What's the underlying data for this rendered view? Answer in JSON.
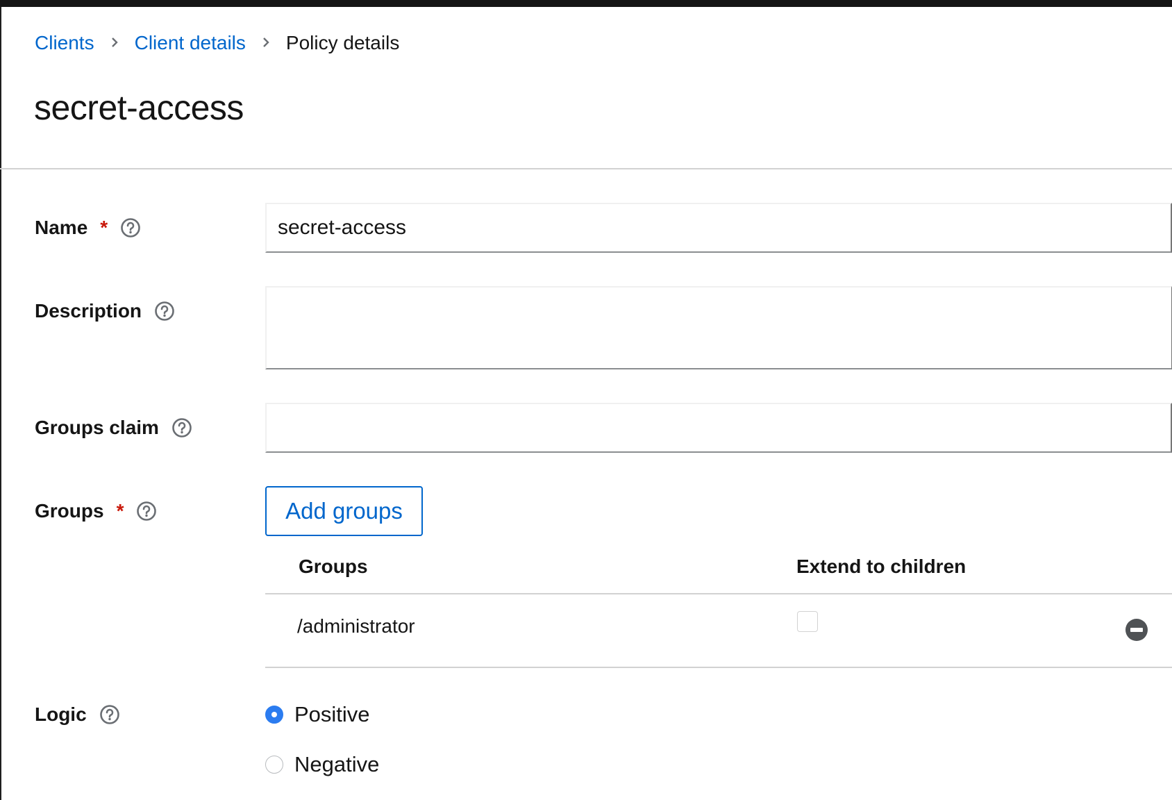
{
  "breadcrumb": {
    "items": [
      "Clients",
      "Client details"
    ],
    "current": "Policy details"
  },
  "page_title": "secret-access",
  "form": {
    "name": {
      "label": "Name",
      "required_mark": "*",
      "value": "secret-access"
    },
    "description": {
      "label": "Description",
      "value": ""
    },
    "groups_claim": {
      "label": "Groups claim",
      "value": ""
    },
    "groups": {
      "label": "Groups",
      "required_mark": "*",
      "add_button": "Add groups",
      "table": {
        "columns": [
          "Groups",
          "Extend to children"
        ],
        "rows": [
          {
            "group": "/administrator",
            "extend_to_children": false
          }
        ]
      }
    },
    "logic": {
      "label": "Logic",
      "options": [
        "Positive",
        "Negative"
      ],
      "selected": "Positive"
    }
  },
  "colors": {
    "link": "#0066cc",
    "required": "#c9190b",
    "radio_selected": "#2b7cf0"
  },
  "icons": {
    "breadcrumb_separator": "chevron-right-icon",
    "help": "help-circle-icon",
    "remove": "minus-circle-icon"
  }
}
